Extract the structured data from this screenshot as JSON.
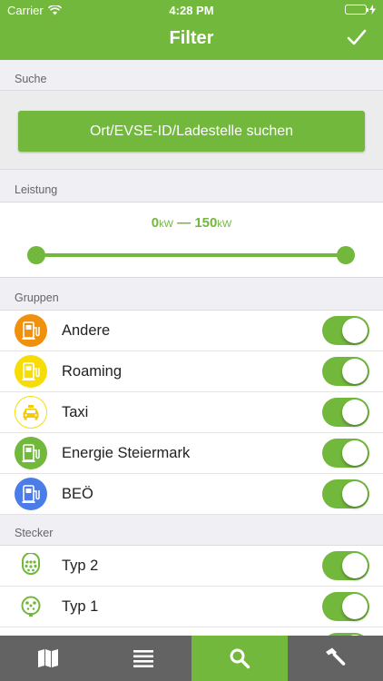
{
  "statusbar": {
    "carrier": "Carrier",
    "time": "4:28 PM"
  },
  "header": {
    "title": "Filter"
  },
  "sections": {
    "search": "Suche",
    "power": "Leistung",
    "groups": "Gruppen",
    "plugs": "Stecker"
  },
  "search": {
    "button_label": "Ort/EVSE-ID/Ladestelle suchen"
  },
  "power": {
    "min_value": "0",
    "max_value": "150",
    "unit": "kW",
    "dash": "—",
    "slider_min": 0,
    "slider_max": 150
  },
  "groups": [
    {
      "label": "Andere",
      "icon": "charging-station-icon",
      "color": "#f0910e",
      "enabled": true
    },
    {
      "label": "Roaming",
      "icon": "charging-station-icon",
      "color": "#f7dd08",
      "enabled": true
    },
    {
      "label": "Taxi",
      "icon": "taxi-icon",
      "color": "#f7dd08",
      "enabled": true
    },
    {
      "label": "Energie Steiermark",
      "icon": "charging-station-icon",
      "color": "#72b83c",
      "enabled": true
    },
    {
      "label": "BEÖ",
      "icon": "charging-station-icon",
      "color": "#4a7de8",
      "enabled": true
    }
  ],
  "plugs": [
    {
      "label": "Typ 2",
      "icon": "type2-plug-icon",
      "enabled": true
    },
    {
      "label": "Typ 1",
      "icon": "type1-plug-icon",
      "enabled": true
    }
  ],
  "tabbar": [
    {
      "name": "map",
      "icon": "map-icon",
      "active": false
    },
    {
      "name": "list",
      "icon": "list-icon",
      "active": false
    },
    {
      "name": "search",
      "icon": "search-icon",
      "active": true
    },
    {
      "name": "tools",
      "icon": "hammer-icon",
      "active": false
    }
  ],
  "colors": {
    "accent": "#72b83c",
    "tabbar": "#636363",
    "background": "#efeff4"
  }
}
